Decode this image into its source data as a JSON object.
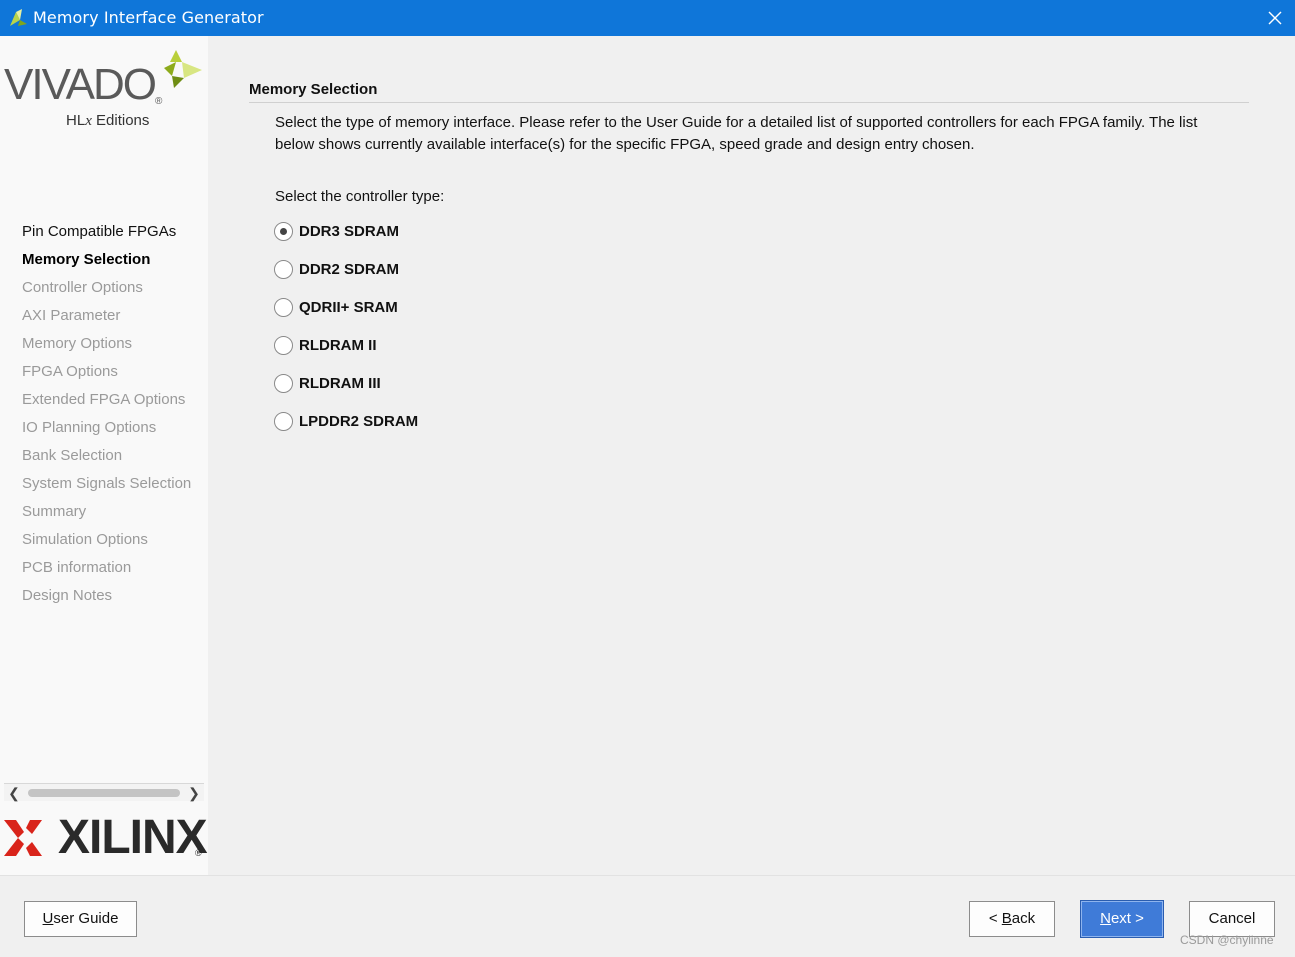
{
  "window": {
    "title": "Memory Interface Generator"
  },
  "sidebar": {
    "logo_top": {
      "word": "VIVADO",
      "registered": "®",
      "sub_prefix": "HL",
      "sub_x": "x",
      "sub_suffix": " Editions"
    },
    "steps": [
      {
        "label": "Pin Compatible FPGAs",
        "state": "done"
      },
      {
        "label": "Memory Selection",
        "state": "active"
      },
      {
        "label": "Controller Options",
        "state": "pending"
      },
      {
        "label": "AXI Parameter",
        "state": "pending"
      },
      {
        "label": "Memory Options",
        "state": "pending"
      },
      {
        "label": "FPGA Options",
        "state": "pending"
      },
      {
        "label": "Extended FPGA Options",
        "state": "pending"
      },
      {
        "label": "IO Planning Options",
        "state": "pending"
      },
      {
        "label": "Bank Selection",
        "state": "pending"
      },
      {
        "label": "System Signals Selection",
        "state": "pending"
      },
      {
        "label": "Summary",
        "state": "pending"
      },
      {
        "label": "Simulation Options",
        "state": "pending"
      },
      {
        "label": "PCB information",
        "state": "pending"
      },
      {
        "label": "Design Notes",
        "state": "pending"
      }
    ],
    "logo_bottom": {
      "word": "XILINX",
      "registered": "®"
    }
  },
  "main": {
    "section_title": "Memory Selection",
    "description": "Select the type of memory interface. Please refer to the User Guide for a detailed list of supported controllers for each FPGA family. The list below shows currently available interface(s) for the specific FPGA, speed grade and design entry chosen.",
    "controller_prompt": "Select the controller type:",
    "controller_options": [
      {
        "label": "DDR3 SDRAM",
        "selected": true
      },
      {
        "label": "DDR2 SDRAM",
        "selected": false
      },
      {
        "label": "QDRII+ SRAM",
        "selected": false
      },
      {
        "label": "RLDRAM II",
        "selected": false
      },
      {
        "label": "RLDRAM III",
        "selected": false
      },
      {
        "label": "LPDDR2 SDRAM",
        "selected": false
      }
    ]
  },
  "footer": {
    "user_guide": {
      "mnemonic": "U",
      "rest": "ser Guide"
    },
    "back": {
      "prefix": "< ",
      "mnemonic": "B",
      "rest": "ack"
    },
    "next": {
      "mnemonic": "N",
      "rest": "ext >"
    },
    "cancel": "Cancel",
    "watermark": "CSDN @chylinne"
  },
  "colors": {
    "titlebar": "#0f76d9",
    "primary_button": "#3f7bd8",
    "xilinx_red": "#d9241b",
    "vivado_green": "#9cbd1e"
  }
}
